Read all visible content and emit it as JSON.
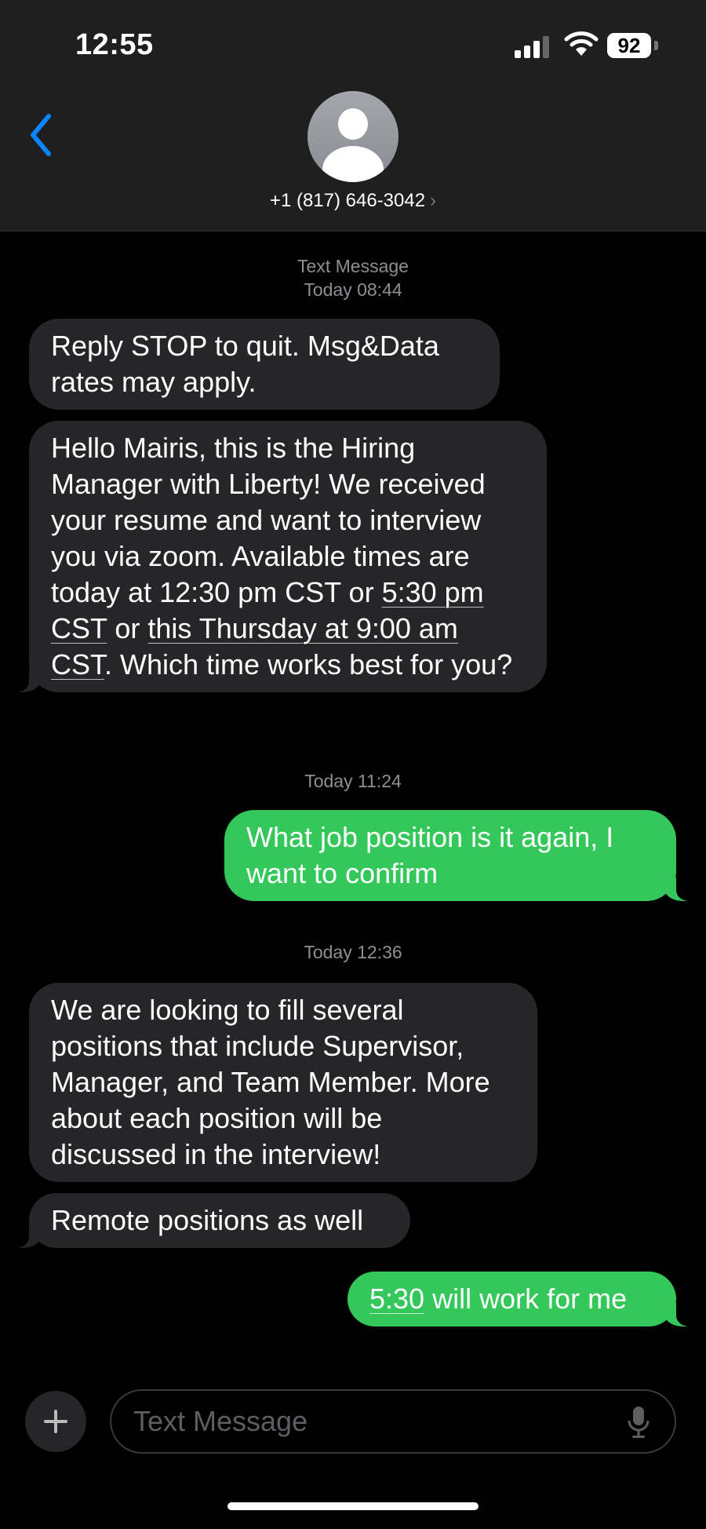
{
  "status": {
    "time": "12:55",
    "battery": "92"
  },
  "header": {
    "contact": "+1 (817) 646-3042",
    "chevron": "›"
  },
  "thread": {
    "stamp1_type": "Text Message",
    "stamp1_time": "Today 08:44",
    "msg1": "Reply STOP to quit. Msg&Data rates may apply.",
    "msg2": {
      "p1": "Hello Mairis, this is the Hiring Manager with Liberty! We received your resume and want to interview you via zoom. Available times are today at 12:30 pm CST or ",
      "link1": "5:30 pm CST",
      "p2": " or ",
      "link2": "this Thursday at 9:00 am CST",
      "p3": ". Which time works best for you?"
    },
    "stamp2": "Today 11:24",
    "msg3": "What job position is it again, I want to confirm",
    "stamp3": "Today 12:36",
    "msg4": "We are looking to fill several positions that include Supervisor, Manager, and Team Member. More about each position will be discussed in the interview!",
    "msg5": "Remote positions as well",
    "msg6": {
      "link": "5:30",
      "rest": " will work for me"
    }
  },
  "compose": {
    "placeholder": "Text Message"
  },
  "colors": {
    "incoming": "#262628",
    "outgoing": "#34c759",
    "accent": "#0a84ff"
  },
  "icons": {
    "back": "chevron-left-icon",
    "add": "plus-icon",
    "mic": "microphone-icon"
  }
}
